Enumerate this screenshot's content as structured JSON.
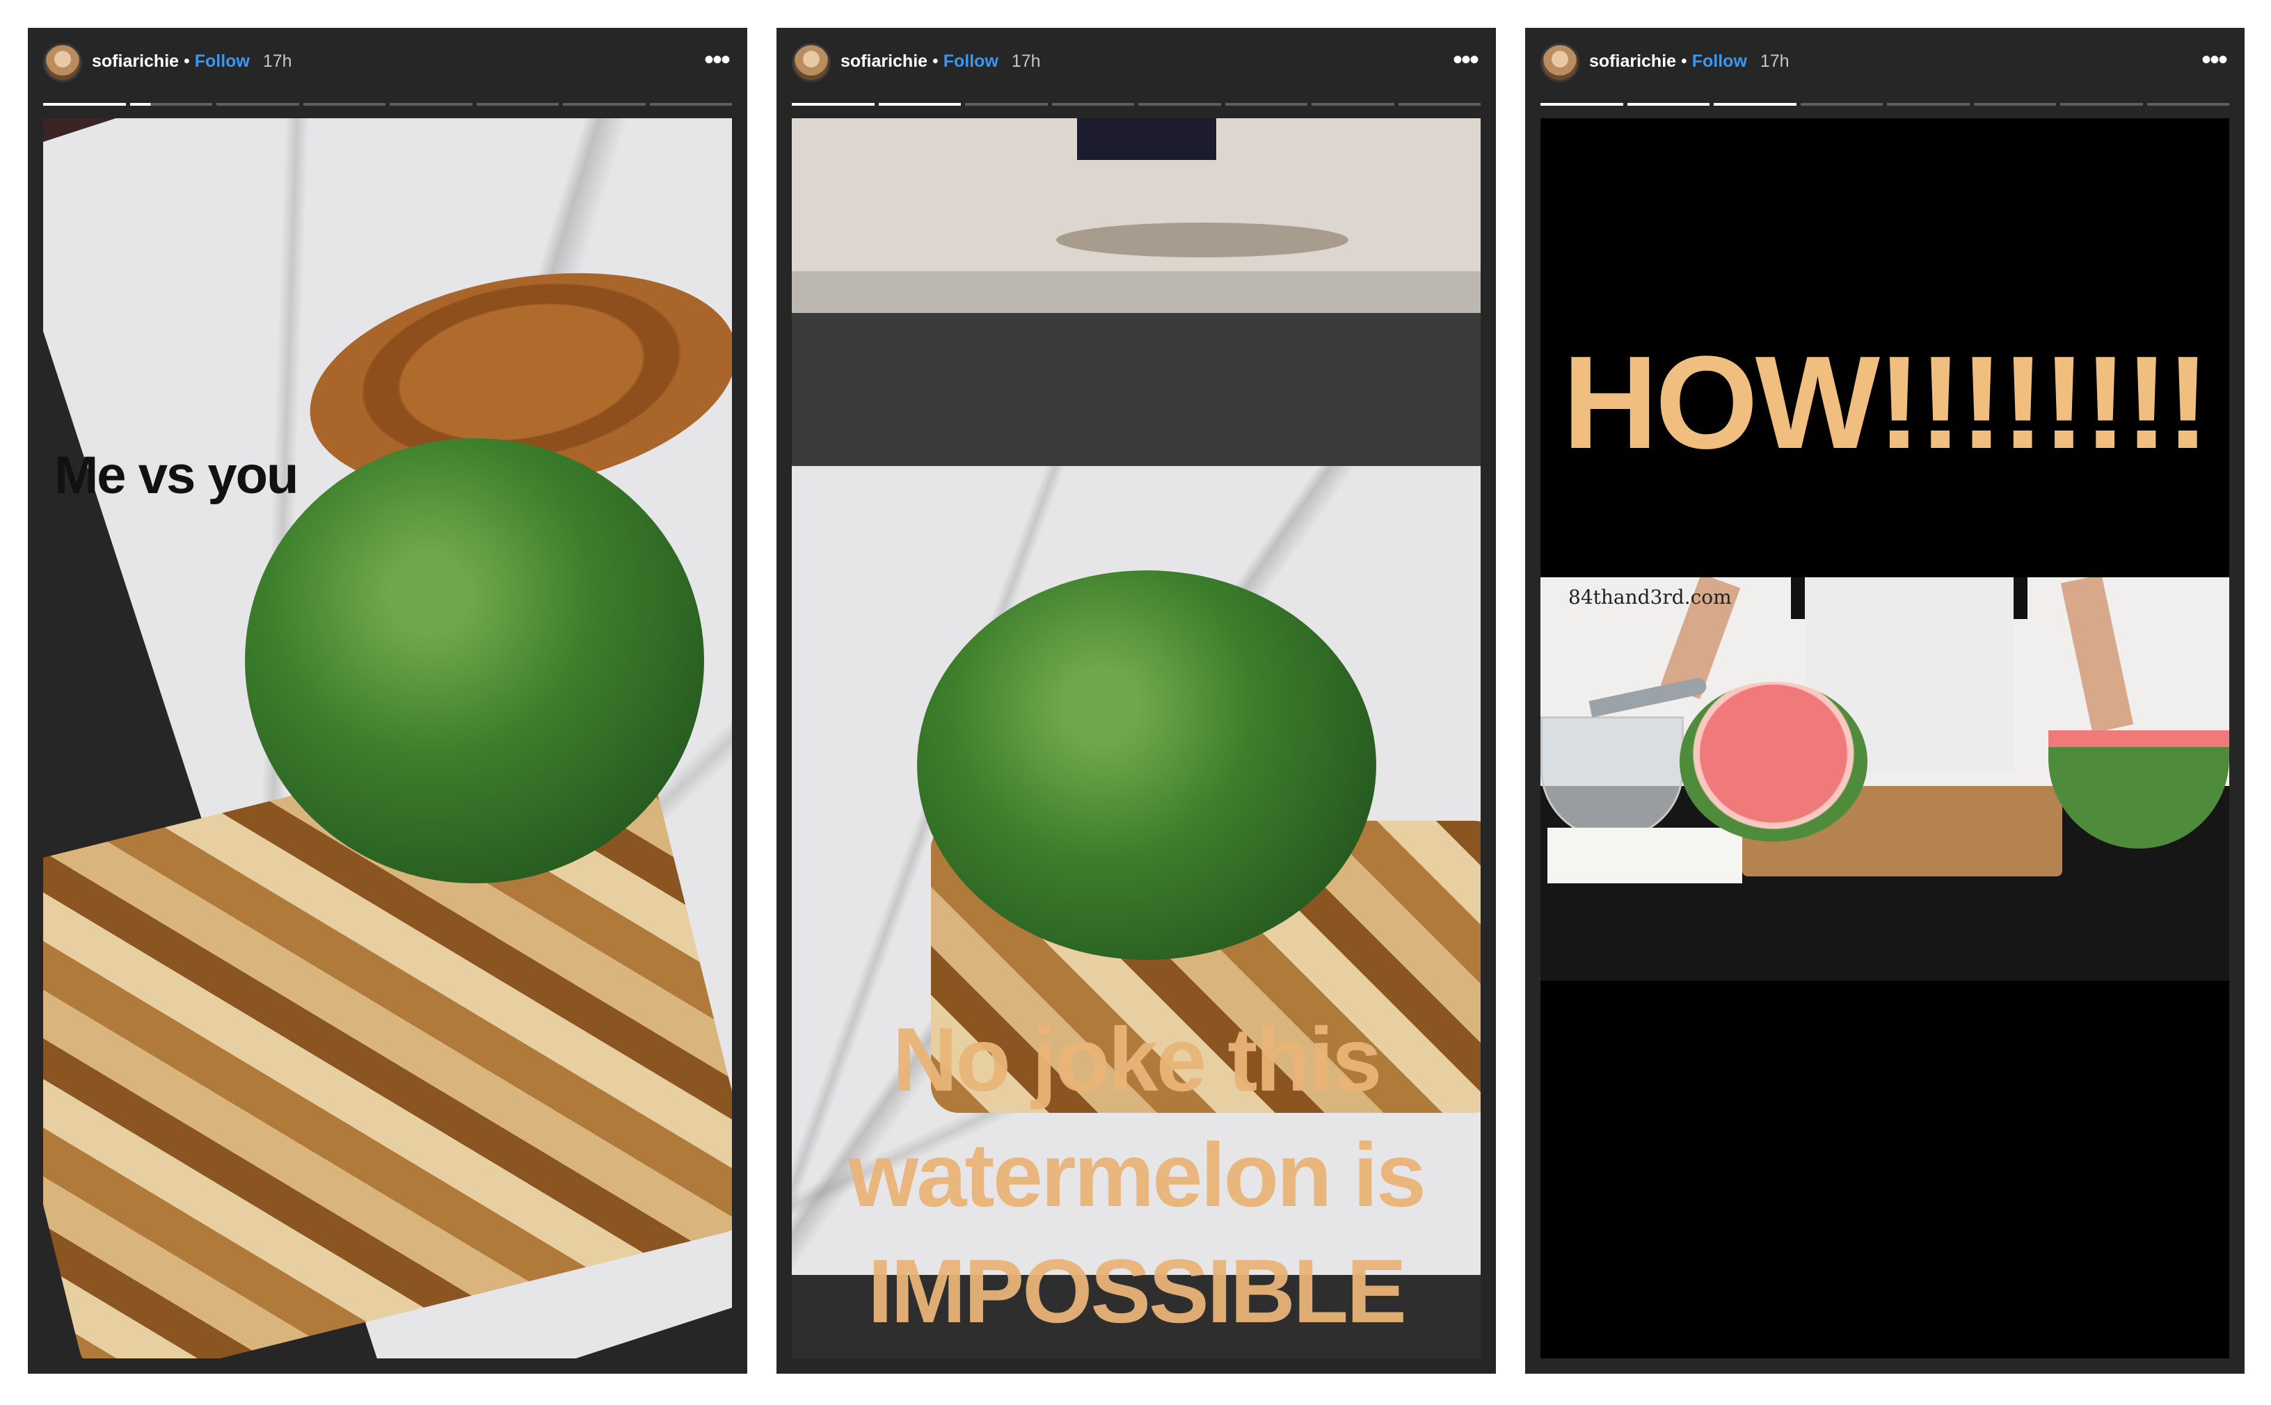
{
  "stories": [
    {
      "username": "sofiarichie",
      "separator": "•",
      "follow_label": "Follow",
      "time": "17h",
      "more_icon": "more-dots-icon",
      "progress": {
        "segments": 8,
        "completed": 1,
        "current_fraction": 0.25
      },
      "caption": "Me vs you"
    },
    {
      "username": "sofiarichie",
      "separator": "•",
      "follow_label": "Follow",
      "time": "17h",
      "more_icon": "more-dots-icon",
      "progress": {
        "segments": 8,
        "completed": 2,
        "current_fraction": 0.0
      },
      "caption_lines": [
        "No joke this",
        "watermelon is",
        "IMPOSSIBLE"
      ]
    },
    {
      "username": "sofiarichie",
      "separator": "•",
      "follow_label": "Follow",
      "time": "17h",
      "more_icon": "more-dots-icon",
      "progress": {
        "segments": 8,
        "completed": 3,
        "current_fraction": 0.0
      },
      "caption": "HOW!!!!!!!!",
      "video_watermark": "84thand3rd.com"
    }
  ],
  "colors": {
    "follow": "#3897f0",
    "caption_orange": "#f0bf80",
    "panel_bg": "#262626"
  }
}
